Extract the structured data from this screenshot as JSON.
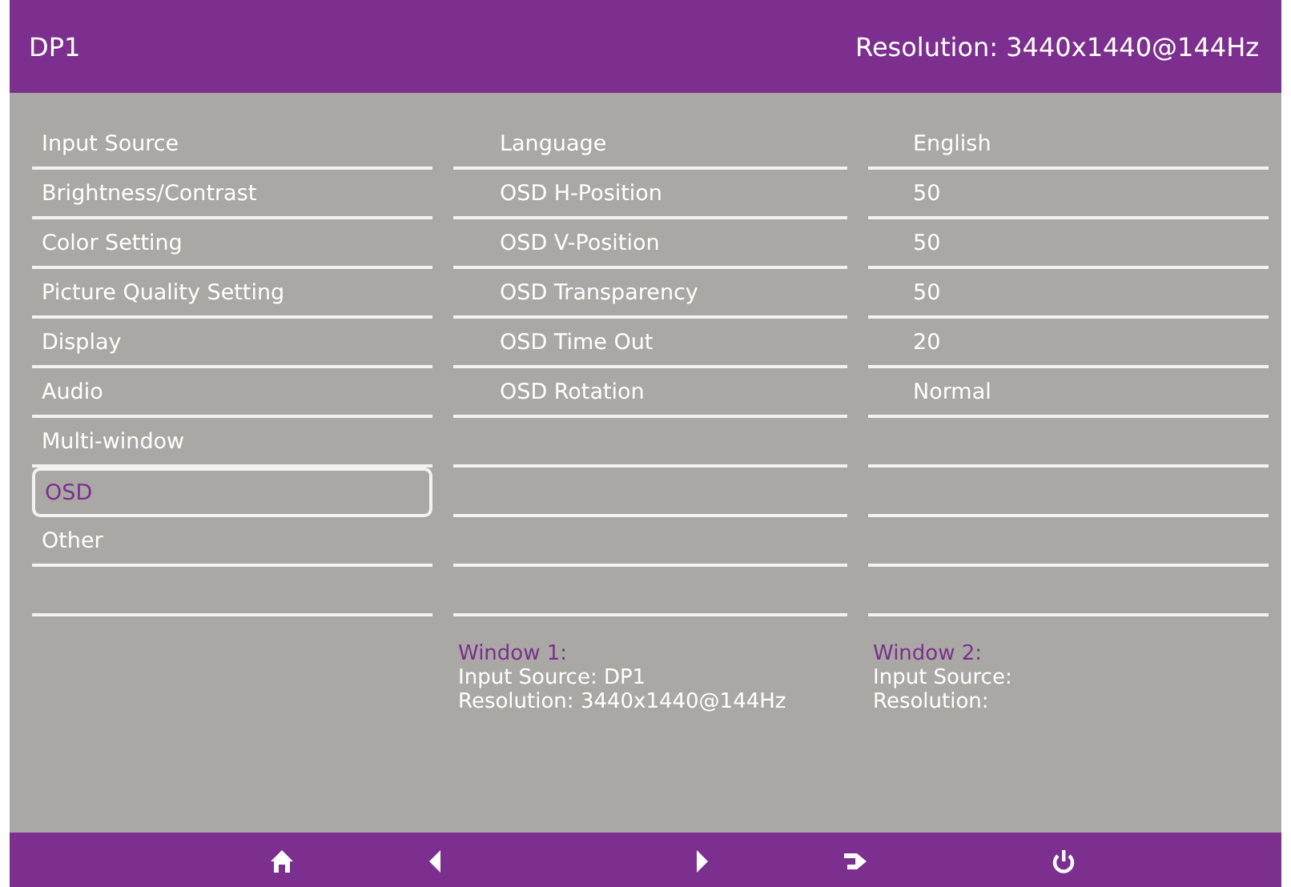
{
  "header": {
    "source": "DP1",
    "resolution": "Resolution: 3440x1440@144Hz"
  },
  "menu": [
    {
      "label": "Input Source",
      "selected": false
    },
    {
      "label": "Brightness/Contrast",
      "selected": false
    },
    {
      "label": "Color Setting",
      "selected": false
    },
    {
      "label": "Picture Quality Setting",
      "selected": false
    },
    {
      "label": "Display",
      "selected": false
    },
    {
      "label": "Audio",
      "selected": false
    },
    {
      "label": "Multi-window",
      "selected": false
    },
    {
      "label": "OSD",
      "selected": true
    },
    {
      "label": "Other",
      "selected": false
    }
  ],
  "settings": [
    {
      "label": "Language",
      "value": "English"
    },
    {
      "label": "OSD H-Position",
      "value": "50"
    },
    {
      "label": "OSD V-Position",
      "value": "50"
    },
    {
      "label": "OSD Transparency",
      "value": "50"
    },
    {
      "label": "OSD Time Out",
      "value": "20"
    },
    {
      "label": "OSD Rotation",
      "value": "Normal"
    }
  ],
  "windows": [
    {
      "title": "Window 1:",
      "lines": [
        "Input Source: DP1",
        "Resolution: 3440x1440@144Hz"
      ]
    },
    {
      "title": "Window 2:",
      "lines": [
        "Input Source:",
        "Resolution:"
      ]
    }
  ],
  "nav": [
    {
      "kind": "home"
    },
    {
      "kind": "left"
    },
    {
      "kind": "right"
    },
    {
      "kind": "enter"
    },
    {
      "kind": "power"
    }
  ]
}
